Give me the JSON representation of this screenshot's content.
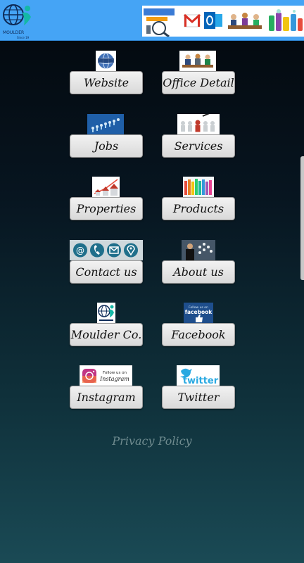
{
  "header": {
    "logo_text": "MOULDER",
    "logo_subtext": "Since 19"
  },
  "buttons": {
    "website": "Website",
    "office_detail": "Office Detail",
    "jobs": "Jobs",
    "services": "Services",
    "properties": "Properties",
    "products": "Products",
    "contact_us": "Contact us",
    "about_us": "About us",
    "moulder_co": "Moulder Co.",
    "facebook": "Facebook",
    "instagram": "Instagram",
    "twitter": "Twitter"
  },
  "thumbs": {
    "facebook_text_top": "Follow us on",
    "facebook_text": "facebook",
    "instagram_text_top": "Follow us on",
    "instagram_text": "Instagram",
    "twitter_text": "twitter"
  },
  "footer": {
    "privacy_policy": "Privacy Policy"
  }
}
